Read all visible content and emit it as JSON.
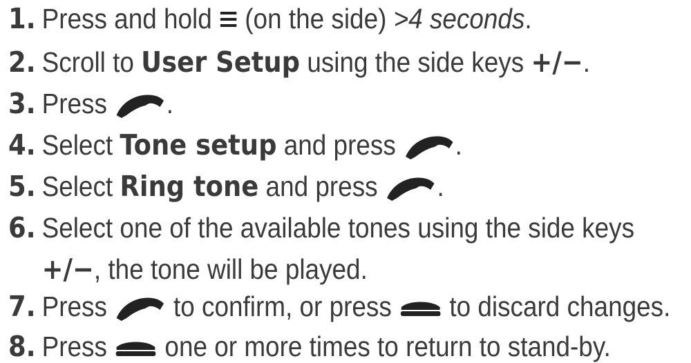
{
  "steps": [
    {
      "num": "1.",
      "p1": "Press and hold ",
      "icon": "menu-icon",
      "p2": " (on the side) ",
      "it": ">4 seconds",
      "p3": "."
    },
    {
      "num": "2.",
      "p1": "Scroll to ",
      "b1": "User Setup",
      "p2": " using the side keys ",
      "keys": "+/−",
      "p3": "."
    },
    {
      "num": "3.",
      "p1": "Press ",
      "icon": "phone-off-hook-icon",
      "p2": "."
    },
    {
      "num": "4.",
      "p1": "Select ",
      "b1": "Tone setup",
      "p2": " and press ",
      "icon": "phone-off-hook-icon",
      "p3": "."
    },
    {
      "num": "5.",
      "p1": "Select ",
      "b1": "Ring tone",
      "p2": " and press ",
      "icon": "phone-off-hook-icon",
      "p3": "."
    },
    {
      "num": "6.",
      "p1": "Select one of the available tones using the side keys",
      "keys": "+/−",
      "p2": ", the tone will be played."
    },
    {
      "num": "7.",
      "p1": "Press ",
      "icon1": "phone-off-hook-icon",
      "p2": " to confirm, or press ",
      "icon2": "phone-on-hook-icon",
      "p3": " to discard changes."
    },
    {
      "num": "8.",
      "p1": "Press ",
      "icon": "phone-on-hook-icon",
      "p2": " one or more times to return to stand-by."
    }
  ],
  "colors": {
    "text": "#3a3a3a",
    "icon": "#222222"
  }
}
